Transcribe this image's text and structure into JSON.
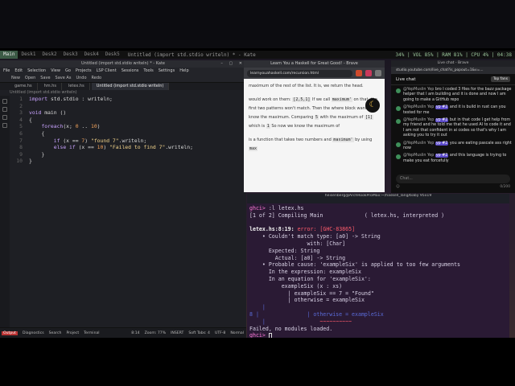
{
  "desktop": {
    "tags": [
      "Main",
      "Desk1",
      "Desk2",
      "Desk3",
      "Desk4",
      "Desk5"
    ],
    "active_tag": "Main",
    "window_title": "Untitled (import std.stdio writeln) * - Kate",
    "status": "34% | VOL 85% | RAM 81% | CPU 4% | 04:38"
  },
  "kate": {
    "title": "Untitled (import std.stdio writeln) * - Kate",
    "menu": [
      "File",
      "Edit",
      "Selection",
      "View",
      "Go",
      "Projects",
      "LSP Client",
      "Sessions",
      "Tools",
      "Settings",
      "Help"
    ],
    "toolbar": [
      "New",
      "Open",
      "Save",
      "Save As",
      "Undo",
      "Redo"
    ],
    "tabs": [
      "game.hs",
      "hm.hs",
      "letex.hs",
      "Untitled (import std.stdio writeln)"
    ],
    "active_tab_index": 3,
    "breadcrumb": "Untitled (import std.stdio writeln)",
    "line_numbers": [
      "1",
      "2",
      "3",
      "4",
      "5",
      "6",
      "7",
      "8",
      "9",
      "10"
    ],
    "status": {
      "output": "Output",
      "diagnostics": "Diagnostics",
      "search": "Search",
      "project": "Project",
      "terminal": "Terminal",
      "position": "8:14",
      "zoom": "Zoom: 77%",
      "mode": "INSERT",
      "tabs": "Soft Tabs: 4",
      "encoding": "UTF-8",
      "syntax": "Normal"
    }
  },
  "doc": {
    "window_title": "Learn You a Haskell for Great Good! - Brave",
    "url": "learnyouahaskell.com/recursion.html",
    "text": {
      "p1": "maximum of the rest of the list. It is, we return the head.",
      "p2": "would work on them:",
      "p3": "[2,5,1]",
      "p4": "If we call",
      "p5": "maximum'",
      "p6": "on that, the first two patterns won't match.",
      "p7": "Then the where block wants to know the maximum. Comparing",
      "p8": "5",
      "p9": "with the maximum of",
      "p10": "[1]",
      "p11": "which is",
      "p12": "1",
      "p13": "So now we know the maximum of",
      "p14": "is a function that takes two numbers and",
      "p15": "maximum'",
      "p16": "by using",
      "p17": "max"
    }
  },
  "terminal": {
    "title": "heisenberg@ArchRookProMax:~/haskell_lang/baby 95x19",
    "prompt": "ghci>",
    "cmd1": ":l letex.hs",
    "compiling": "[1 of 2] Compiling Main             ( letex.hs, interpreted )",
    "err_loc": "letex.hs:8:19:",
    "err_word": "error:",
    "err_code": "[GHC-83865]",
    "e1": "    • Couldn't match type: [a0] -> String",
    "e2": "                  with: [Char]",
    "e3": "      Expected: String",
    "e4": "        Actual: [a0] -> String",
    "e5": "    • Probable cause: 'exampleSix' is applied to too few arguments",
    "e6": "      In the expression: exampleSix",
    "e7": "      In an equation for 'exampleSix':",
    "e8": "          exampleSix (x : xs)",
    "e9": "            | exampleSix == 7 = \"Found\"",
    "e10": "            | otherwise = exampleSix",
    "src_line": "8 |               | otherwise = exampleSix",
    "caret": "~~~~~~~~~~",
    "failed": "Failed, no modules loaded."
  },
  "chat": {
    "window_title": "Live chat - Brave",
    "url": "studio.youtube.com/live_chat?is_popout=1&v=...",
    "header": "Live chat",
    "top_fans": "Top fans",
    "messages": [
      {
        "name": "@YepMuslin Yep",
        "text": "bro I coded 3 files for the bazz package helper that I am building and it is done and now I am going to make a GitHub repo"
      },
      {
        "name": "@YepMuslin Yep",
        "badge": "yp #2",
        "text": "and it is build in rust can you tested for me"
      },
      {
        "name": "@YepMuslin Yep",
        "badge": "yp #2",
        "text": "but in that code I get help from my friend and he told me that he used AI to code it and I am not that confident in ai codes so that's why I am asking you to try it out"
      },
      {
        "name": "@YepMuslin Yep",
        "badge": "yp #2",
        "text": "you are eating pascale ass right now"
      },
      {
        "name": "@YepMuslin Yep",
        "badge": "yp #2",
        "text": "and this language is trying to make you eat forcefully"
      }
    ],
    "input_placeholder": "Chat...",
    "counter": "0/200"
  }
}
